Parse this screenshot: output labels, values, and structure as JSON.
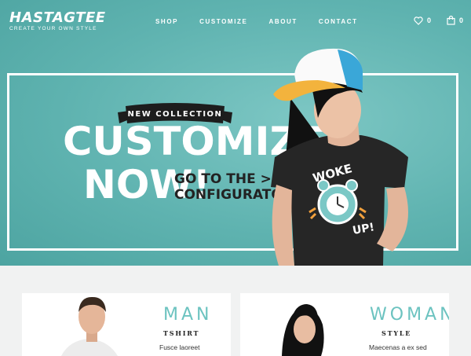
{
  "brand": {
    "name": "HASTAGTEE",
    "tagline": "CREATE YOUR OWN STYLE"
  },
  "nav": {
    "items": [
      {
        "label": "SHOP"
      },
      {
        "label": "CUSTOMIZE"
      },
      {
        "label": "ABOUT"
      },
      {
        "label": "CONTACT"
      }
    ],
    "wishlist_count": "0",
    "cart_count": "0"
  },
  "hero": {
    "ribbon": "NEW COLLECTION",
    "headline_line1": "CUSTOMIZE",
    "headline_line2": "NOW!",
    "cta_line1": "GO TO THE >>",
    "cta_line2": "CONFIGURATOR",
    "shirt_print_top": "WOKE",
    "shirt_print_bottom": "UP!"
  },
  "cards": [
    {
      "title": "MAN",
      "subtitle": "TSHIRT",
      "text": "Fusce laoreet"
    },
    {
      "title": "WOMAN",
      "subtitle": "STYLE",
      "text": "Maecenas a ex sed"
    }
  ],
  "colors": {
    "accent": "#5fb3b0",
    "card_title": "#6cc3c0",
    "cap_visor": "#f3b33d",
    "cap_mesh": "#3aa7d8"
  }
}
